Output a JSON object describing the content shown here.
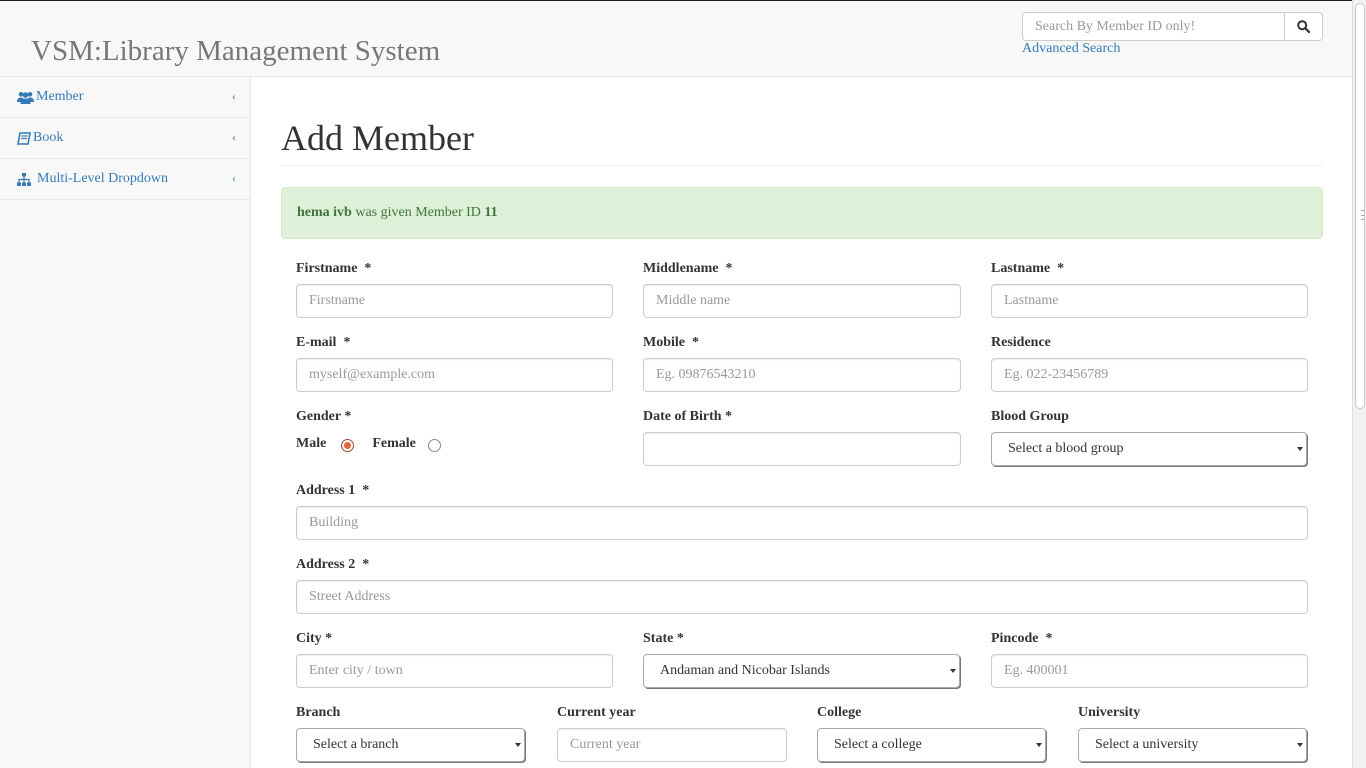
{
  "header": {
    "brand": "VSM:Library Management System",
    "search_placeholder": "Search By Member ID only!",
    "advanced_search": "Advanced Search"
  },
  "sidebar": {
    "items": [
      {
        "label": "Member",
        "icon": "users-icon"
      },
      {
        "label": "Book",
        "icon": "book-icon"
      },
      {
        "label": "Multi-Level Dropdown",
        "icon": "sitemap-icon"
      }
    ]
  },
  "page": {
    "title": "Add Member",
    "alert": {
      "name": "hema ivb",
      "text": " was given Member ID ",
      "member_id": "11"
    }
  },
  "form": {
    "firstname": {
      "label": "Firstname  *",
      "placeholder": "Firstname"
    },
    "middlename": {
      "label": "Middlename  *",
      "placeholder": "Middle name"
    },
    "lastname": {
      "label": "Lastname  *",
      "placeholder": "Lastname"
    },
    "email": {
      "label": "E-mail  *",
      "placeholder": "myself@example.com"
    },
    "mobile": {
      "label": "Mobile  *",
      "placeholder": "Eg. 09876543210"
    },
    "residence": {
      "label": "Residence",
      "placeholder": "Eg. 022-23456789"
    },
    "gender": {
      "label": "Gender *",
      "male": "Male",
      "female": "Female",
      "selected": "Male"
    },
    "dob": {
      "label": "Date of Birth *",
      "value": ""
    },
    "blood_group": {
      "label": "Blood Group",
      "selected": "Select a blood group"
    },
    "address1": {
      "label": "Address 1  *",
      "placeholder": "Building"
    },
    "address2": {
      "label": "Address 2  *",
      "placeholder": "Street Address"
    },
    "city": {
      "label": "City *",
      "placeholder": "Enter city / town"
    },
    "state": {
      "label": "State *",
      "selected": "Andaman and Nicobar Islands"
    },
    "pincode": {
      "label": "Pincode  *",
      "placeholder": "Eg. 400001"
    },
    "branch": {
      "label": "Branch",
      "selected": "Select a branch"
    },
    "current_year": {
      "label": "Current year",
      "placeholder": "Current year"
    },
    "college": {
      "label": "College",
      "selected": "Select a college"
    },
    "university": {
      "label": "University",
      "selected": "Select a university"
    }
  },
  "colors": {
    "link": "#337ab7",
    "alert_bg": "#dff0d8",
    "alert_text": "#3c763d",
    "radio_selected": "#e0643c"
  }
}
